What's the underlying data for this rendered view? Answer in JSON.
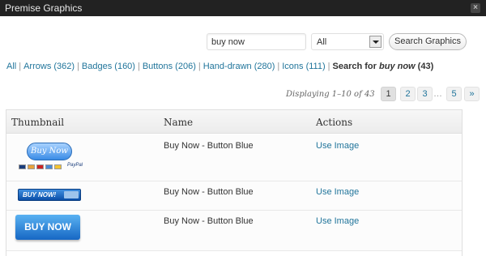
{
  "window": {
    "title": "Premise Graphics",
    "close_glyph": "×"
  },
  "search": {
    "value": "buy now",
    "button_label": "Search Graphics"
  },
  "category_select": {
    "selected": "All"
  },
  "filters": {
    "items": [
      {
        "label": "All"
      },
      {
        "label": "Arrows (362)"
      },
      {
        "label": "Badges (160)"
      },
      {
        "label": "Buttons (206)"
      },
      {
        "label": "Hand-drawn (280)"
      },
      {
        "label": "Icons (111)"
      }
    ],
    "current_prefix": "Search for",
    "current_term": "buy now",
    "current_count": "(43)"
  },
  "pagination": {
    "displaying": "Displaying 1–10 of 43",
    "pages": [
      "1",
      "2",
      "3"
    ],
    "ellipsis": "…",
    "last": "5",
    "next": "»"
  },
  "table": {
    "headers": {
      "thumbnail": "Thumbnail",
      "name": "Name",
      "actions": "Actions"
    },
    "rows": [
      {
        "name": "Buy Now - Button Blue",
        "action": "Use Image",
        "thumb_text": "Buy Now",
        "thumb_extra": "PayPal"
      },
      {
        "name": "Buy Now - Button Blue",
        "action": "Use Image",
        "thumb_text": "BUY NOW!"
      },
      {
        "name": "Buy Now - Button Blue",
        "action": "Use Image",
        "thumb_text": "BUY NOW"
      }
    ]
  },
  "colors": {
    "link": "#21759b",
    "titlebar": "#222222",
    "thumb_blue": "#1667c4"
  }
}
